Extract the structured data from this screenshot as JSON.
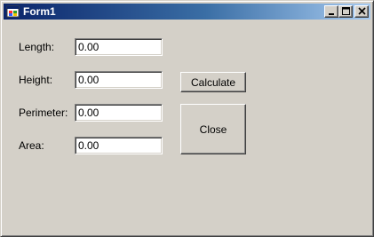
{
  "window": {
    "title": "Form1",
    "icon": "windows-form-icon"
  },
  "caption_buttons": {
    "minimize_icon": "minimize-icon",
    "maximize_icon": "maximize-icon",
    "close_icon": "close-icon"
  },
  "fields": {
    "length": {
      "label": "Length:",
      "value": "0.00"
    },
    "height": {
      "label": "Height:",
      "value": "0.00"
    },
    "perimeter": {
      "label": "Perimeter:",
      "value": "0.00"
    },
    "area": {
      "label": "Area:",
      "value": "0.00"
    }
  },
  "buttons": {
    "calculate_label": "Calculate",
    "close_label": "Close"
  },
  "colors": {
    "titlebar_start": "#0a246a",
    "titlebar_end": "#a6caf0",
    "face": "#d4d0c8"
  }
}
